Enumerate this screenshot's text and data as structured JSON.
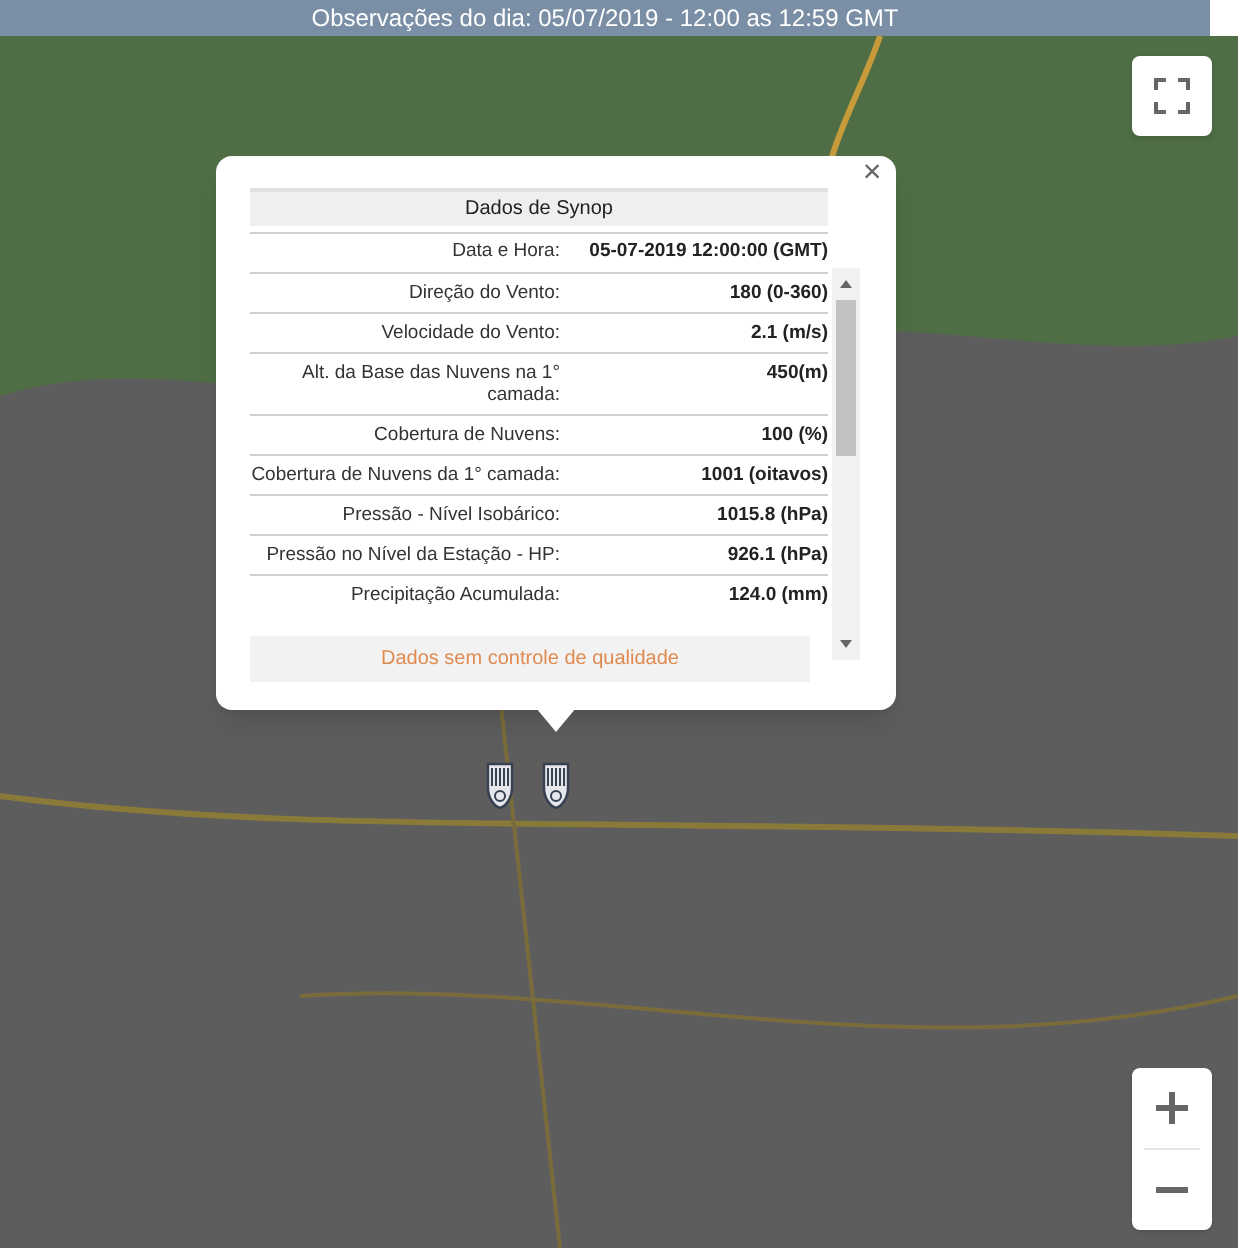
{
  "header": {
    "title": "Observações do dia: 05/07/2019 - 12:00 as 12:59 GMT"
  },
  "popup": {
    "title": "Dados de Synop",
    "close": "×",
    "rows": [
      {
        "label": "Data e Hora:",
        "value": "05-07-2019 12:00:00 (GMT)"
      },
      {
        "label": "Direção do Vento:",
        "value": "180 (0-360)"
      },
      {
        "label": "Velocidade do Vento:",
        "value": "2.1 (m/s)"
      },
      {
        "label": "Alt. da Base das Nuvens na 1° camada:",
        "value": "450(m)"
      },
      {
        "label": "Cobertura de Nuvens:",
        "value": "100 (%)"
      },
      {
        "label": "Cobertura de Nuvens da 1° camada:",
        "value": "1001 (oitavos)"
      },
      {
        "label": "Pressão - Nível Isobárico:",
        "value": "1015.8 (hPa)"
      },
      {
        "label": "Pressão no Nível da Estação - HP:",
        "value": "926.1 (hPa)"
      },
      {
        "label": "Precipitação Acumulada:",
        "value": "124.0 (mm)"
      }
    ],
    "footer": "Dados sem controle de qualidade"
  },
  "map": {
    "markers": [
      {
        "kind": "station"
      },
      {
        "kind": "station"
      }
    ]
  }
}
